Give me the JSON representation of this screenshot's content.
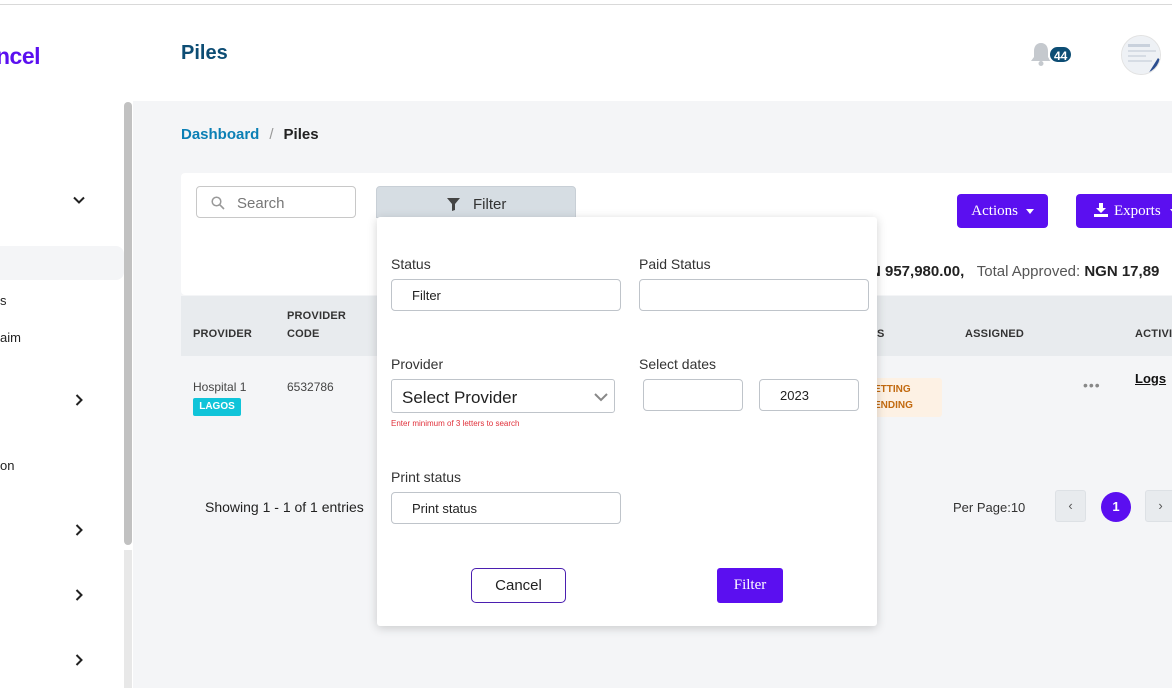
{
  "app": {
    "logo_text": "ncel"
  },
  "header": {
    "title": "Piles",
    "notification_count": "44"
  },
  "breadcrumb": {
    "home": "Dashboard",
    "separator": "/",
    "current": "Piles"
  },
  "sidebar": {
    "fragments": [
      {
        "text": "s"
      },
      {
        "text": "aim"
      },
      {
        "text": "on"
      }
    ]
  },
  "toolbar": {
    "search_placeholder": "Search",
    "filter_label": "Filter",
    "actions_label": "Actions",
    "exports_label": "Exports"
  },
  "totals": {
    "partial_value": "N 957,980.00,",
    "approved_label": "Total Approved:",
    "approved_value": "NGN 17,89"
  },
  "table": {
    "headers": [
      "PROVIDER",
      "PROVIDER CODE",
      "S",
      "ASSIGNED",
      "ACTIVI"
    ],
    "rows": [
      {
        "provider": "Hospital 1",
        "location_tag": "LAGOS",
        "provider_code": "6532786",
        "status_line1": "ETTING",
        "status_line2": "ENDING",
        "action_link": "Logs"
      }
    ]
  },
  "pagination": {
    "showing": "Showing 1 - 1 of 1 entries",
    "per_page": "Per Page:10",
    "prev": "‹",
    "current": "1",
    "next": "›"
  },
  "filter_panel": {
    "status_label": "Status",
    "status_placeholder": "Filter",
    "paid_status_label": "Paid Status",
    "paid_status_value": "",
    "provider_label": "Provider",
    "provider_select": "Select Provider",
    "provider_hint": "Enter minimum of 3 letters to search",
    "dates_label": "Select dates",
    "date_start": "",
    "date_end": "2023",
    "print_status_label": "Print status",
    "print_status_placeholder": "Print status",
    "cancel_label": "Cancel",
    "filter_label": "Filter"
  },
  "colors": {
    "brand": "#5b0ff0",
    "title": "#0d4d74",
    "link": "#0a7fb5",
    "tag": "#10c4d9"
  }
}
